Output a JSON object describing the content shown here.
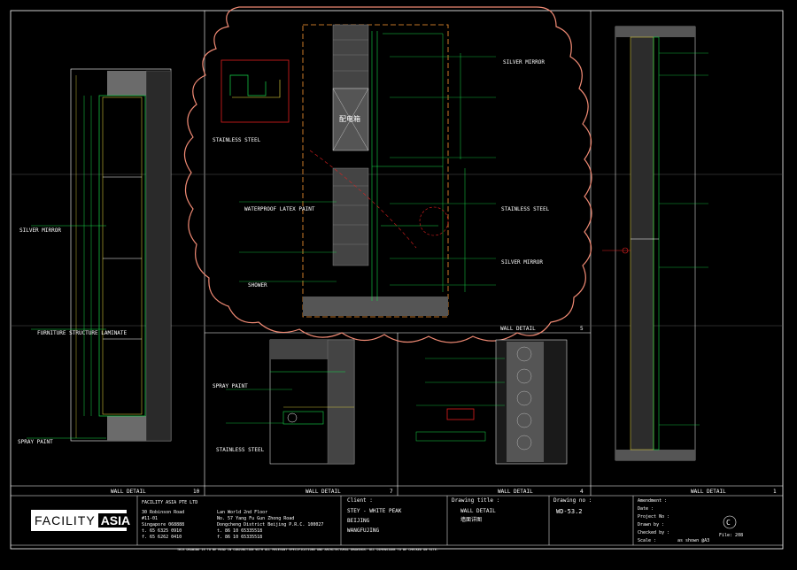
{
  "panels": [
    {
      "title": "WALL DETAIL",
      "sheet": "10"
    },
    {
      "title": "WALL DETAIL",
      "sheet": "7"
    },
    {
      "title": "WALL DETAIL",
      "sheet": "4"
    },
    {
      "title": "WALL DETAIL",
      "sheet": "1"
    },
    {
      "title": "WALL DETAIL",
      "sheet": "5"
    }
  ],
  "annotations": {
    "mirror": "SILVER MIRROR",
    "steel": "STAINLESS STEEL",
    "latex": "WATERPROOF LATEX PAINT",
    "spray": "SPRAY PAINT",
    "laminate": "FURNITURE STRUCTURE LAMINATE",
    "tile": "SHOWER"
  },
  "company": {
    "logo_left": "FACILITY",
    "logo_right": "ASIA",
    "name": "FACILITY ASIA PTE LTD",
    "addr1": "30 Robinson Road",
    "addr2": "#11-01",
    "addr3": "Singapore 068888",
    "tel": "t. 65 6325 0910",
    "fax": "f. 65 6262 0410",
    "cn_addr1": "Lan World 2nd Floor",
    "cn_addr2": "No. 57 Yang Fu Gun Zhong Road",
    "cn_addr3": "Dongcheng District Beijing P.R.C. 100027",
    "cn_tel": "t. 86 10 65335518",
    "cn_fax": "f. 86 10 65335518"
  },
  "client": {
    "label": "Client :",
    "line1": "STEY - WHITE PEAK",
    "line2": "BEIJING",
    "line3": "WANGFUJING"
  },
  "drawing_title": {
    "label": "Drawing title :",
    "line1": "WALL DETAIL",
    "line2": "墙面详图"
  },
  "drawing_no": {
    "label": "Drawing no :",
    "value": "WD-53.2"
  },
  "meta": {
    "amendment_label": "Amendment :",
    "date_label": "Date :",
    "project_label": "Project No :",
    "drawn_label": "Drawn by :",
    "checked_label": "Checked by :",
    "scale_label": "Scale :",
    "scale_value": "as shown @A3",
    "file": "File: 208"
  },
  "footer_note": "THIS DRAWING IS TO BE READ IN CONJUNCTION WITH ALL RELEVANT SPECIFICATIONS AND ARCHITECTURAL DRAWINGS. ALL DIMENSIONS TO BE CHECKED ON SITE."
}
